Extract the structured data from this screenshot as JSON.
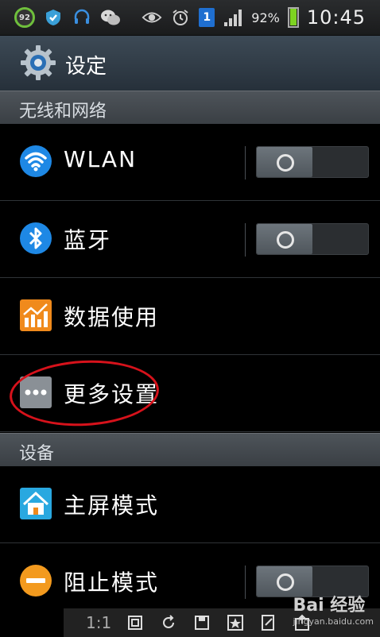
{
  "status_bar": {
    "battery_circle": "92",
    "sim_slot": "1",
    "battery_percent": "92%",
    "time": "10:45",
    "icons": [
      "battery-circle-icon",
      "shield-icon",
      "headset-icon",
      "wechat-icon",
      "eye-icon",
      "alarm-icon",
      "sim-icon",
      "signal-icon",
      "battery-icon"
    ]
  },
  "header": {
    "title": "设定",
    "icon": "gear-icon"
  },
  "sections": [
    {
      "label": "无线和网络"
    },
    {
      "label": "设备"
    }
  ],
  "items": [
    {
      "label": "WLAN",
      "icon": "wifi-icon",
      "toggle": "off"
    },
    {
      "label": "蓝牙",
      "icon": "bluetooth-icon",
      "toggle": "off"
    },
    {
      "label": "数据使用",
      "icon": "data-usage-icon"
    },
    {
      "label": "更多设置",
      "icon": "more-icon"
    },
    {
      "label": "主屏模式",
      "icon": "home-icon"
    },
    {
      "label": "阻止模式",
      "icon": "block-icon",
      "toggle": "off"
    }
  ],
  "bottom_bar": {
    "ratio": "1:1"
  },
  "watermark": {
    "brand": "Bai 经验",
    "url": "jingyan.baidu.com"
  },
  "colors": {
    "highlight": "#d6121b",
    "accent": "#1e88e5"
  }
}
